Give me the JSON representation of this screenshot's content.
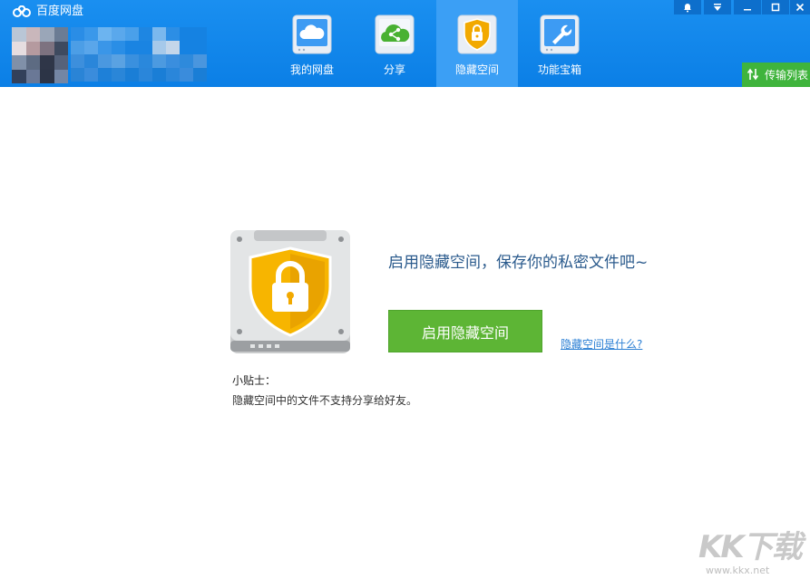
{
  "app": {
    "title": "百度网盘"
  },
  "nav": {
    "tabs": [
      {
        "label": "我的网盘",
        "icon": "cloud-icon",
        "active": false
      },
      {
        "label": "分享",
        "icon": "share-icon",
        "active": false
      },
      {
        "label": "隐藏空间",
        "icon": "lock-shield-icon",
        "active": true
      },
      {
        "label": "功能宝箱",
        "icon": "wrench-icon",
        "active": false
      }
    ]
  },
  "window_controls": [
    "bell-icon",
    "dropdown-icon",
    "minimize-icon",
    "maximize-icon",
    "close-icon"
  ],
  "transfer": {
    "label": "传输列表",
    "icon": "transfer-arrows-icon"
  },
  "main": {
    "headline": "启用隐藏空间，保存你的私密文件吧~",
    "enable_button": "启用隐藏空间",
    "help_link": "隐藏空间是什么?",
    "tip_title": "小贴士：",
    "tip_text": "隐藏空间中的文件不支持分享给好友。"
  },
  "watermark": {
    "text": "KK下载",
    "url": "www.kkx.net"
  },
  "colors": {
    "topbar": "#0b7fe6",
    "active_tab": "#3b9ff5",
    "transfer_button": "#3fb43c",
    "primary_button": "#5db535",
    "headline": "#2a5a8c",
    "link": "#2b7fd4"
  }
}
